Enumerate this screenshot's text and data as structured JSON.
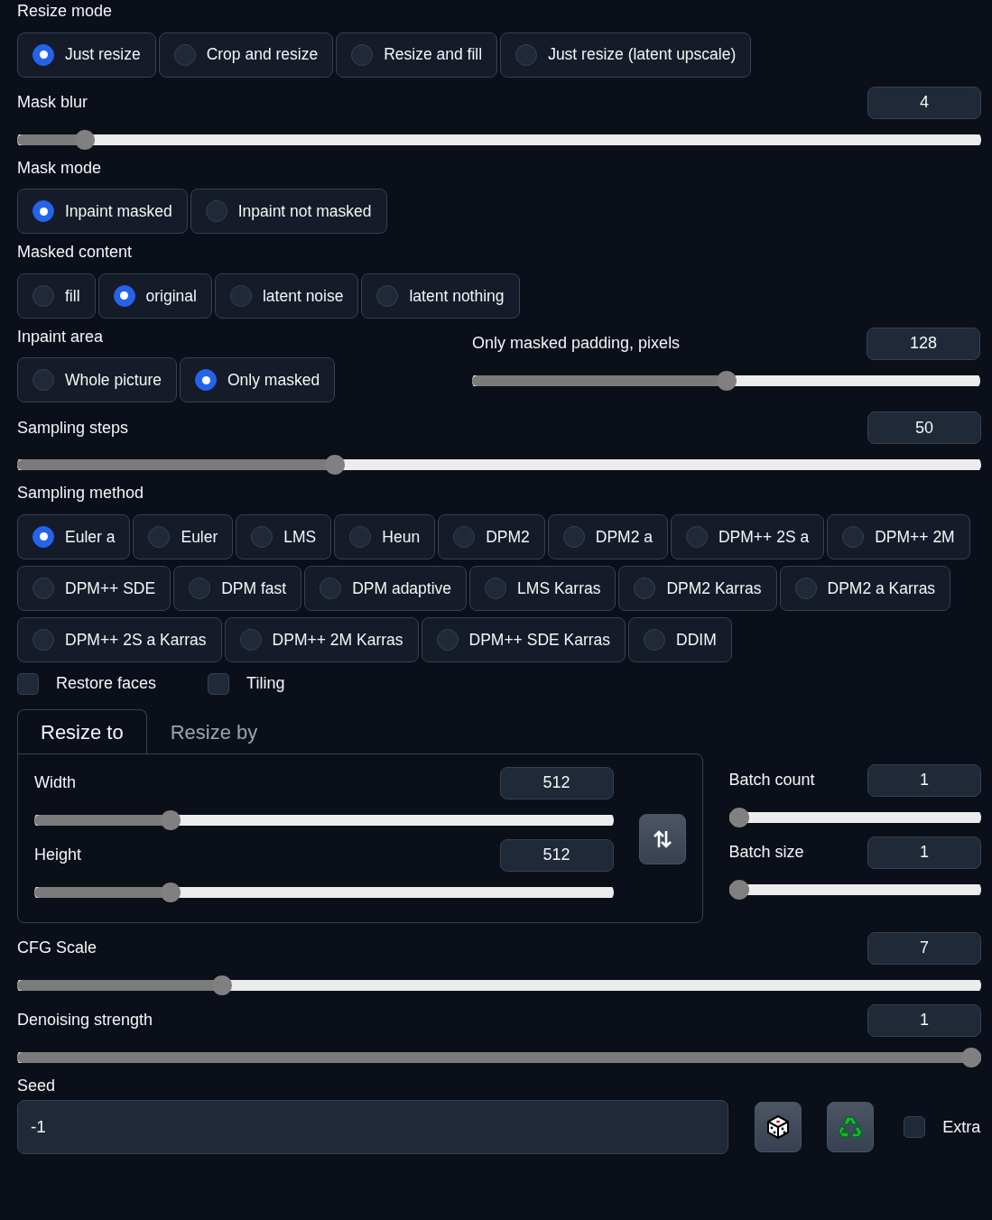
{
  "controls": [
    {
      "kind": "radio",
      "label": "Resize mode",
      "options": [
        {
          "label": "Just resize",
          "selected": true
        },
        {
          "label": "Crop and resize",
          "selected": false
        },
        {
          "label": "Resize and fill",
          "selected": false
        },
        {
          "label": "Just resize (latent upscale)",
          "selected": false
        }
      ]
    },
    {
      "kind": "slider",
      "label": "Mask blur",
      "value": "4",
      "level": 0.07
    },
    {
      "kind": "radio",
      "label": "Mask mode",
      "options": [
        {
          "label": "Inpaint masked",
          "selected": true
        },
        {
          "label": "Inpaint not masked",
          "selected": false
        }
      ]
    },
    {
      "kind": "radio",
      "label": "Masked content",
      "options": [
        {
          "label": "fill",
          "selected": false
        },
        {
          "label": "original",
          "selected": true
        },
        {
          "label": "latent noise",
          "selected": false
        },
        {
          "label": "latent nothing",
          "selected": false
        }
      ]
    },
    {
      "kind": "pair",
      "items": [
        {
          "kind": "radio",
          "label": "Inpaint area",
          "options": [
            {
              "label": "Whole picture",
              "selected": false
            },
            {
              "label": "Only masked",
              "selected": true
            }
          ]
        },
        {
          "kind": "slider",
          "label": "Only masked padding, pixels",
          "value": "128",
          "level": 0.5
        }
      ]
    },
    {
      "kind": "slider",
      "label": "Sampling steps",
      "value": "50",
      "level": 0.33
    },
    {
      "kind": "radio",
      "label": "Sampling method",
      "options": [
        {
          "label": "Euler a",
          "selected": true
        },
        {
          "label": "Euler",
          "selected": false
        },
        {
          "label": "LMS",
          "selected": false
        },
        {
          "label": "Heun",
          "selected": false
        },
        {
          "label": "DPM2",
          "selected": false
        },
        {
          "label": "DPM2 a",
          "selected": false
        },
        {
          "label": "DPM++ 2S a",
          "selected": false
        },
        {
          "label": "DPM++ 2M",
          "selected": false
        },
        {
          "label": "DPM++ SDE",
          "selected": false
        },
        {
          "label": "DPM fast",
          "selected": false
        },
        {
          "label": "DPM adaptive",
          "selected": false
        },
        {
          "label": "LMS Karras",
          "selected": false
        },
        {
          "label": "DPM2 Karras",
          "selected": false
        },
        {
          "label": "DPM2 a Karras",
          "selected": false
        },
        {
          "label": "DPM++ 2S a Karras",
          "selected": false
        },
        {
          "label": "DPM++ 2M Karras",
          "selected": false
        },
        {
          "label": "DPM++ SDE Karras",
          "selected": false
        },
        {
          "label": "DDIM",
          "selected": false
        }
      ]
    },
    {
      "kind": "checks",
      "items": [
        {
          "label": "Restore faces",
          "checked": false
        },
        {
          "label": "Tiling",
          "checked": false
        }
      ]
    },
    {
      "kind": "tabs",
      "tabs": [
        {
          "label": "Resize to",
          "selected": true
        },
        {
          "label": "Resize by",
          "selected": false
        }
      ],
      "left": [
        {
          "kind": "slider",
          "label": "Width",
          "value": "512",
          "level": 0.236
        },
        {
          "kind": "slider",
          "label": "Height",
          "value": "512",
          "level": 0.236
        }
      ],
      "right": [
        {
          "kind": "slider",
          "label": "Batch count",
          "value": "1",
          "level": 0
        },
        {
          "kind": "slider",
          "label": "Batch size",
          "value": "1",
          "level": 0
        }
      ]
    },
    {
      "kind": "slider",
      "label": "CFG Scale",
      "value": "7",
      "level": 0.213
    },
    {
      "kind": "slider",
      "label": "Denoising strength",
      "value": "1",
      "level": 1
    },
    {
      "kind": "seed",
      "label": "Seed",
      "value": "-1",
      "extra": {
        "label": "Extra",
        "checked": false
      }
    }
  ]
}
